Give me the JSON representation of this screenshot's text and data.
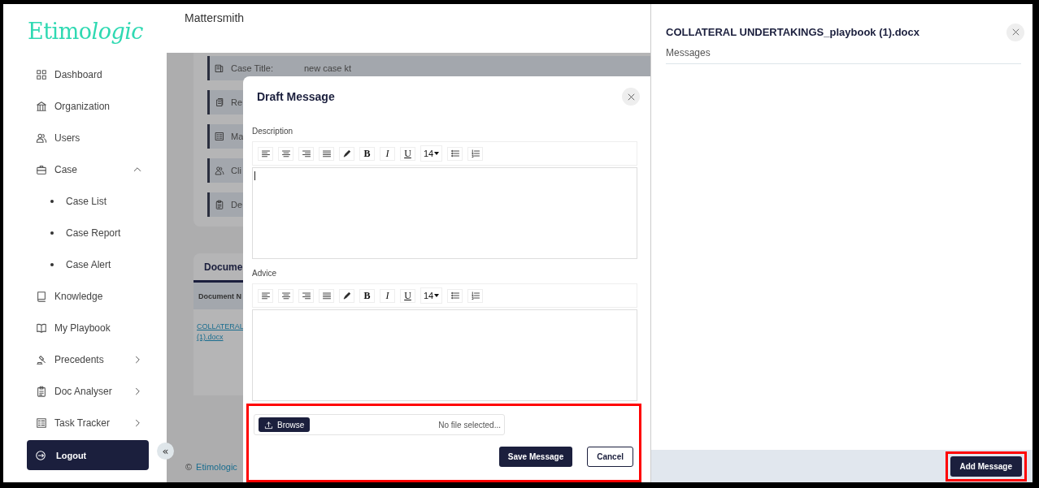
{
  "sidebar": {
    "logo": [
      "Etimo",
      "logic"
    ],
    "items": [
      {
        "label": "Dashboard"
      },
      {
        "label": "Organization"
      },
      {
        "label": "Users"
      },
      {
        "label": "Case",
        "expanded": true,
        "children": [
          {
            "label": "Case List"
          },
          {
            "label": "Case Report"
          },
          {
            "label": "Case Alert"
          }
        ]
      },
      {
        "label": "Knowledge"
      },
      {
        "label": "My Playbook"
      },
      {
        "label": "Precedents",
        "expanded": false
      },
      {
        "label": "Doc Analyser",
        "expanded": false
      },
      {
        "label": "Task Tracker",
        "expanded": false
      }
    ],
    "logout": {
      "label": "Logout"
    },
    "collapse": "«"
  },
  "header": {
    "title": "Mattersmith"
  },
  "case_details": [
    {
      "label": "Case Title:",
      "value": "new case kt"
    },
    {
      "label": "Re"
    },
    {
      "label": "Ma"
    },
    {
      "label": "Cli"
    },
    {
      "label": "De"
    }
  ],
  "documents": {
    "tab": "Docume",
    "column_1": "Document N",
    "link_lines": [
      "COLLATERAL",
      "(1).docx"
    ]
  },
  "footer": {
    "symbol": "©",
    "link": "Etimologic"
  },
  "modal": {
    "title": "Draft Message",
    "editors": [
      {
        "label": "Description",
        "caret": true,
        "toolbar": [
          {
            "kind": "align-left"
          },
          {
            "kind": "align-center"
          },
          {
            "kind": "align-right"
          },
          {
            "kind": "justify"
          },
          {
            "kind": "pen"
          },
          {
            "kind": "bold",
            "label": "B"
          },
          {
            "kind": "italic",
            "label": "I"
          },
          {
            "kind": "underline",
            "label": "U"
          },
          {
            "kind": "size",
            "label": "14"
          },
          {
            "kind": "bullets"
          },
          {
            "kind": "numbers"
          }
        ]
      },
      {
        "label": "Advice",
        "caret": false,
        "toolbar": [
          {
            "kind": "align-left"
          },
          {
            "kind": "align-center"
          },
          {
            "kind": "align-right"
          },
          {
            "kind": "justify"
          },
          {
            "kind": "pen"
          },
          {
            "kind": "bold",
            "label": "B"
          },
          {
            "kind": "italic",
            "label": "I"
          },
          {
            "kind": "underline",
            "label": "U"
          },
          {
            "kind": "size",
            "label": "14"
          },
          {
            "kind": "bullets"
          },
          {
            "kind": "numbers"
          }
        ]
      }
    ],
    "footer": {
      "highlighted": true,
      "browse": "Browse",
      "file_status": "No file selected...",
      "save": "Save Message",
      "cancel": "Cancel"
    }
  },
  "panel": {
    "title": "COLLATERAL UNDERTAKINGS_playbook (1).docx",
    "section": "Messages",
    "add_button": {
      "label": "Add Message",
      "highlighted": true
    }
  }
}
